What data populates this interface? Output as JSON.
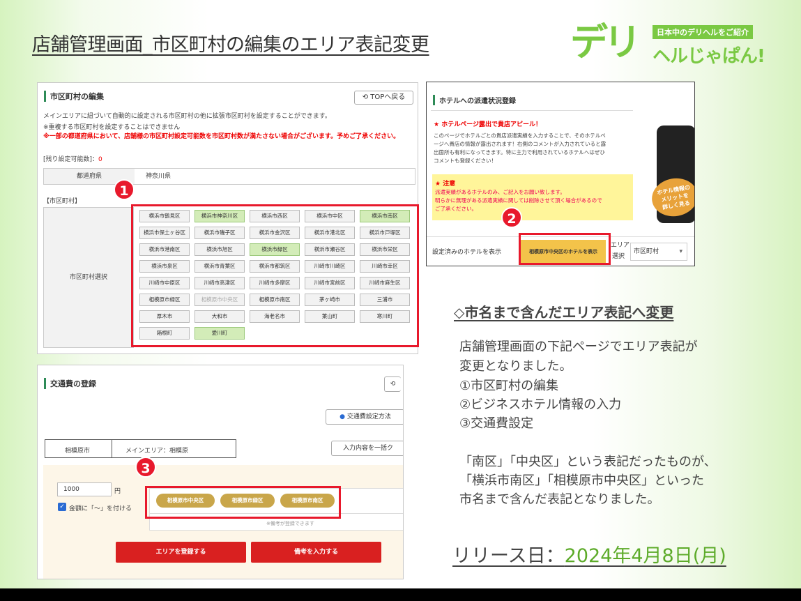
{
  "title": "店舗管理画面_市区町村の編集のエリア表記変更",
  "logo": {
    "big": "デリ",
    "sub": "日本中のデリヘルをご紹介",
    "sub2": "ヘルじゃぱん!"
  },
  "panel1": {
    "heading": "市区町村の編集",
    "top_button": "TOPへ戻る",
    "desc1": "メインエリアに紐づいて自動的に設定される市区町村の他に拡張市区町村を設定することができます。",
    "desc2": "※重複する市区町村を設定することはできません",
    "warning": "※一部の都道府県において、店舗様の市区町村設定可能数を市区町村数が満たさない場合がございます。予めご了承ください。",
    "remaining_label": "[残り設定可能数]：",
    "remaining_value": "0",
    "pref_label": "都道府県",
    "pref_value": "神奈川県",
    "city_section": "【市区町村】",
    "city_select_label": "市区町村選択",
    "cities": [
      {
        "name": "横浜市鶴見区",
        "state": "off"
      },
      {
        "name": "横浜市神奈川区",
        "state": "on"
      },
      {
        "name": "横浜市西区",
        "state": "off"
      },
      {
        "name": "横浜市中区",
        "state": "off"
      },
      {
        "name": "横浜市南区",
        "state": "on"
      },
      {
        "name": "横浜市保土ヶ谷区",
        "state": "off"
      },
      {
        "name": "横浜市磯子区",
        "state": "off"
      },
      {
        "name": "横浜市金沢区",
        "state": "off"
      },
      {
        "name": "横浜市港北区",
        "state": "off"
      },
      {
        "name": "横浜市戸塚区",
        "state": "off"
      },
      {
        "name": "横浜市港南区",
        "state": "off"
      },
      {
        "name": "横浜市旭区",
        "state": "off"
      },
      {
        "name": "横浜市緑区",
        "state": "on"
      },
      {
        "name": "横浜市瀬谷区",
        "state": "off"
      },
      {
        "name": "横浜市栄区",
        "state": "off"
      },
      {
        "name": "横浜市泉区",
        "state": "off"
      },
      {
        "name": "横浜市青葉区",
        "state": "off"
      },
      {
        "name": "横浜市都筑区",
        "state": "off"
      },
      {
        "name": "川崎市川崎区",
        "state": "off"
      },
      {
        "name": "川崎市幸区",
        "state": "off"
      },
      {
        "name": "川崎市中原区",
        "state": "off"
      },
      {
        "name": "川崎市高津区",
        "state": "off"
      },
      {
        "name": "川崎市多摩区",
        "state": "off"
      },
      {
        "name": "川崎市宮前区",
        "state": "off"
      },
      {
        "name": "川崎市麻生区",
        "state": "off"
      },
      {
        "name": "相模原市緑区",
        "state": "off"
      },
      {
        "name": "相模原市中央区",
        "state": "dis"
      },
      {
        "name": "相模原市南区",
        "state": "off"
      },
      {
        "name": "茅ヶ崎市",
        "state": "off"
      },
      {
        "name": "三浦市",
        "state": "off"
      },
      {
        "name": "厚木市",
        "state": "off"
      },
      {
        "name": "大和市",
        "state": "off"
      },
      {
        "name": "海老名市",
        "state": "off"
      },
      {
        "name": "葉山町",
        "state": "off"
      },
      {
        "name": "寒川町",
        "state": "off"
      },
      {
        "name": "箱根町",
        "state": "off"
      },
      {
        "name": "愛川町",
        "state": "on"
      }
    ]
  },
  "panel2": {
    "heading": "ホテルへの派遣状況登録",
    "appeal_title": "★ ホテルページ露出で貴店アピール！",
    "appeal_lines": [
      "このページでホテルごとの貴店派遣実績を入力することで、そのホテルペ",
      "ージへ貴店の情報が露出されます！右側のコメントが入力されていると露",
      "出箇所も有利になってきます。特に主力で利用されているホテルへはぜひ",
      "コメントも登録ください！"
    ],
    "caution_title": "★ 注意",
    "caution_lines": [
      "派遣実績があるホテルのみ、ご記入をお願い致します。",
      "明らかに無理がある派遣実績に関しては削除させて頂く場合があるので",
      "ご了承ください。"
    ],
    "phone_badge": "ホテル情報の\nメリットを\n詳しく見る",
    "opt_set": "設定済みのホテルを表示",
    "opt_selected": "相模原市中央区のホテルを表示",
    "area_label1": "エリア",
    "area_label2": "選択",
    "area_value": "市区町村"
  },
  "panel3": {
    "heading": "交通費の登録",
    "method_button": "交通費設定方法",
    "main_city": "相模原市",
    "main_area": "メインエリア：相模原",
    "bulk_button": "入力内容を一括ク",
    "fee_value": "1000",
    "yen": "円",
    "checkbox_label": "金額に「～」を付ける",
    "chips": [
      "相模原市中央区",
      "相模原市緑区",
      "相模原市南区"
    ],
    "note": "※備考が登録できます",
    "btn_area": "エリアを登録する",
    "btn_note": "備考を入力する"
  },
  "markers": [
    "1",
    "2",
    "3"
  ],
  "section": {
    "heading": "◇市名まで含んだエリア表記へ変更",
    "lines": [
      "店舗管理画面の下記ページでエリア表記が",
      "変更となりました。",
      "①市区町村の編集",
      "②ビジネスホテル情報の入力",
      "③交通費設定"
    ],
    "lines2": [
      "「南区」「中央区」という表記だったものが、",
      "「横浜市南区」「相模原市中央区」といった",
      "市名まで含んだ表記となりました。"
    ]
  },
  "release": {
    "label": "リリース日：",
    "date": "2024年4月8日(月)"
  },
  "colors": {
    "accent_green": "#7ac943",
    "marker_red": "#e8192c",
    "selected_city": "#d3ecb8",
    "chip_gold": "#c9a64a"
  }
}
